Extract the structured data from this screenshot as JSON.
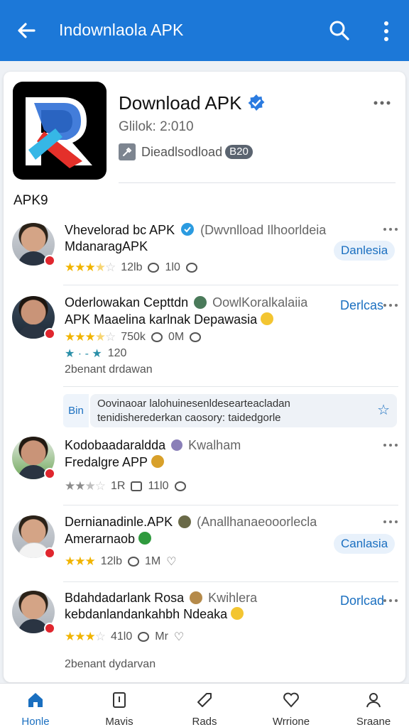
{
  "appbar": {
    "title": "Indownlaola APK"
  },
  "header": {
    "app_title": "Download APK",
    "meta": "Glilok: 2:010",
    "download_label": "Dieadlsodload",
    "download_badge": "B20",
    "section_label": "APK9"
  },
  "posts": [
    {
      "name": "Vhevelorad bc APK",
      "name_sub": "(Dwvnlload Ilhoorldeia",
      "line2": "MdanaragAPK",
      "rating": 3.5,
      "stats_count": "12lb",
      "comments": "1l0",
      "action": "Danlesia"
    },
    {
      "name": "Oderlowakan Cepttdn",
      "name_sub": "OowlKoralkalaiia",
      "line2": "APK Maaelina karlnak Depawasia",
      "rating": 3.5,
      "stats_count": "750k",
      "comments": "0M",
      "extra_count": "120",
      "note": "2benant drdawan",
      "action": "Derlcas"
    },
    {
      "name": "Kodobaadaraldda",
      "name_sub": "Kwalham",
      "line2": "Fredalgre APP",
      "rating": 2.5,
      "stats_count": "1R",
      "comments": "11l0"
    },
    {
      "name": "Dernianadinle.APK",
      "name_sub": "(Anallhanaeooorlecla",
      "line2": "Amerarnaob",
      "rating": 3,
      "stats_count": "12lb",
      "comments": "1M",
      "action": "Canlasia"
    },
    {
      "name": "Bdahdadarlank Rosa",
      "name_sub": "Kwihlera",
      "line2": "kebdanlandankahbh Ndeaka",
      "rating": 3,
      "stats_count": "41l0",
      "comments": "Mr",
      "note": "2benant dydarvan",
      "action": "Dorlcad"
    }
  ],
  "promo": {
    "tag": "Bin",
    "line1": "Oovinaoar lalohuinesenldesearteacladan",
    "line2": "tenidisherederkan caosory: taidedgorle"
  },
  "bottomnav": [
    {
      "label": "Honle",
      "icon": "home-icon"
    },
    {
      "label": "Mavis",
      "icon": "tablet-icon"
    },
    {
      "label": "Rads",
      "icon": "tag-icon"
    },
    {
      "label": "Wrrione",
      "icon": "heart-icon"
    },
    {
      "label": "Sraane",
      "icon": "profile-icon"
    }
  ],
  "colors": {
    "appbar": "#1c78d8",
    "accent": "#1a6fc0",
    "star": "#f1b400"
  }
}
